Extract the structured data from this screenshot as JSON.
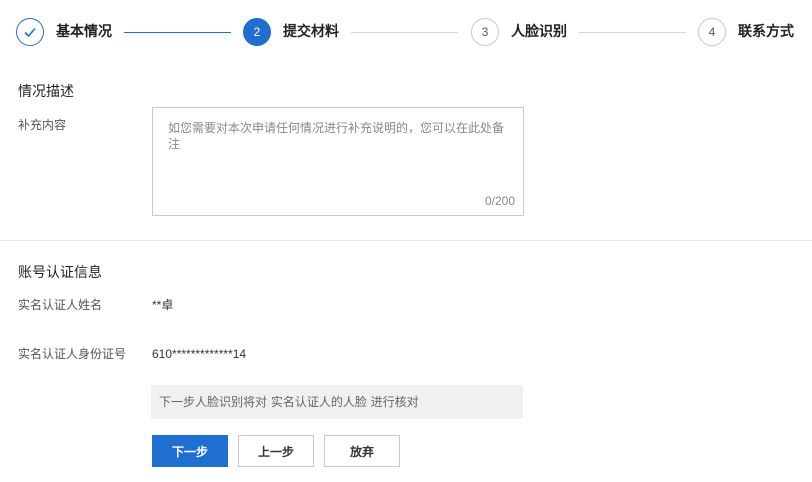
{
  "steps": [
    {
      "number": "",
      "label": "基本情况",
      "state": "done",
      "icon": "check-icon"
    },
    {
      "number": "2",
      "label": "提交材料",
      "state": "active"
    },
    {
      "number": "3",
      "label": "人脸识别",
      "state": "pending"
    },
    {
      "number": "4",
      "label": "联系方式",
      "state": "pending"
    }
  ],
  "description_section": {
    "title": "情况描述",
    "supplement_label": "补充内容",
    "textarea_value": "",
    "textarea_placeholder": "如您需要对本次申请任何情况进行补充说明的，您可以在此处备注",
    "char_count": "0/200"
  },
  "account_section": {
    "title": "账号认证信息",
    "name_label": "实名认证人姓名",
    "name_value": "**卓",
    "id_label": "实名认证人身份证号",
    "id_value": "610*************14"
  },
  "notice": "下一步人脸识别将对 实名认证人的人脸 进行核对",
  "buttons": {
    "next": "下一步",
    "prev": "上一步",
    "abandon": "放弃"
  },
  "colors": {
    "accent": "#1e6fd0",
    "border": "#c9c9c9",
    "notice_bg": "#f0f0f0"
  }
}
